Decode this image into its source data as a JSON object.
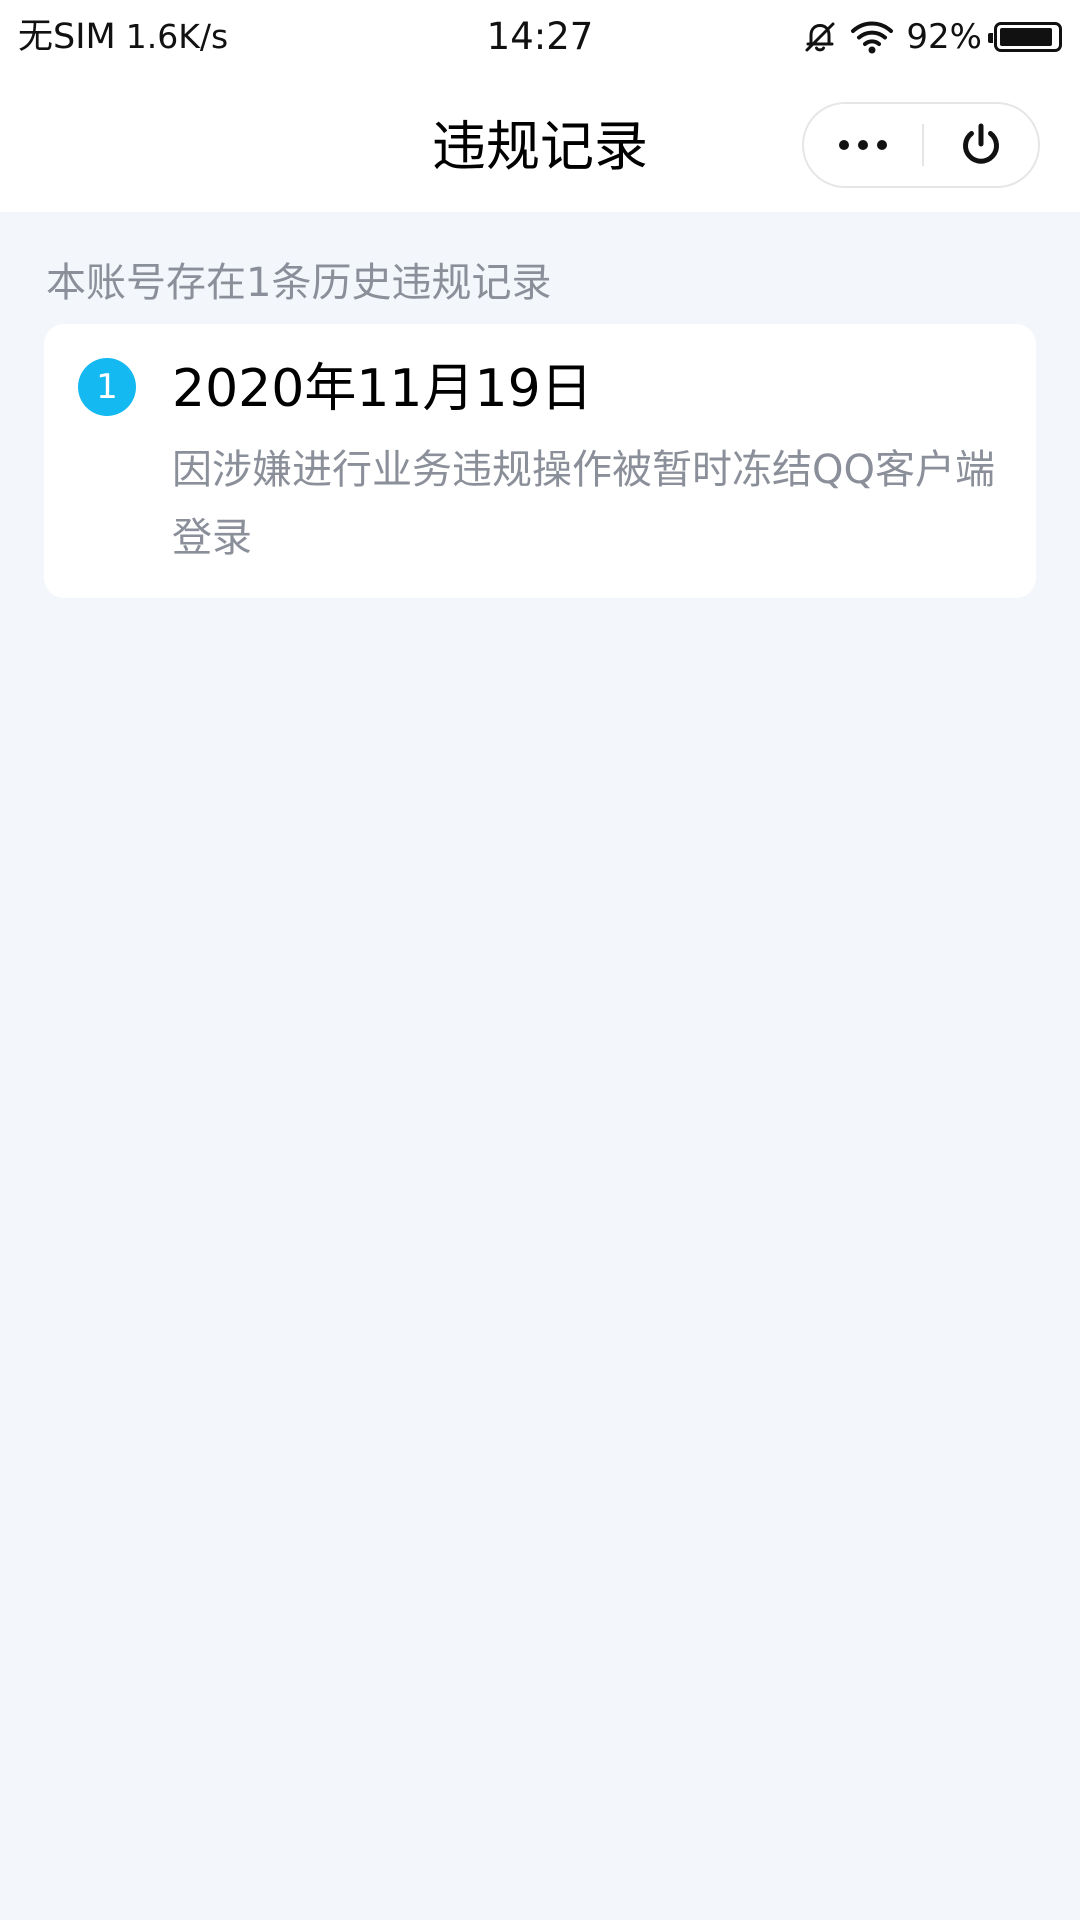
{
  "status_bar": {
    "carrier": "无SIM",
    "speed": "1.6K/s",
    "time": "14:27",
    "battery_percent": "92%",
    "battery_level": 0.92,
    "icons": [
      "bell-off-icon",
      "wifi-icon",
      "battery-icon"
    ]
  },
  "nav": {
    "title": "违规记录",
    "more_icon": "more-dots-icon",
    "close_icon": "power-icon"
  },
  "summary": "本账号存在1条历史违规记录",
  "records": [
    {
      "index": "1",
      "date": "2020年11月19日",
      "description": "因涉嫌进行业务违规操作被暂时冻结QQ客户端登录"
    }
  ],
  "colors": {
    "page_background": "#f3f6fa",
    "badge": "#13b9f0",
    "secondary_text": "#8a8f99"
  }
}
